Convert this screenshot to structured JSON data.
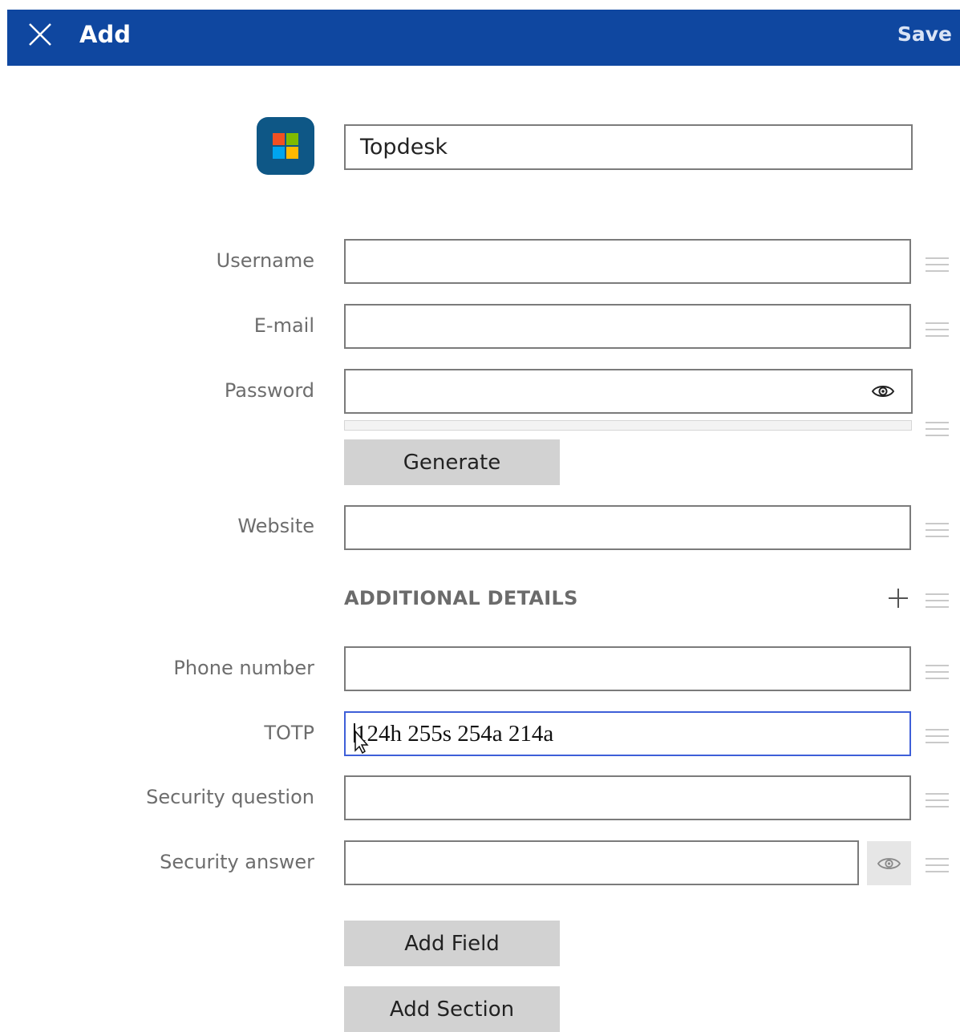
{
  "header": {
    "title": "Add",
    "save_label": "Save",
    "background_color": "#0f47a0"
  },
  "entry": {
    "title_value": "Topdesk",
    "icon": "windows-logo-icon"
  },
  "fields": {
    "username": {
      "label": "Username",
      "value": ""
    },
    "email": {
      "label": "E-mail",
      "value": ""
    },
    "password": {
      "label": "Password",
      "value": "",
      "strength_percent": 0
    },
    "website": {
      "label": "Website",
      "value": ""
    }
  },
  "generate_label": "Generate",
  "additional_details": {
    "title": "ADDITIONAL DETAILS",
    "phone_number": {
      "label": "Phone number",
      "value": ""
    },
    "totp": {
      "label": "TOTP",
      "value": "124h 255s 254a 214a"
    },
    "security_question": {
      "label": "Security question",
      "value": ""
    },
    "security_answer": {
      "label": "Security answer",
      "value": ""
    }
  },
  "add_field_label": "Add Field",
  "add_section_label": "Add Section",
  "colors": {
    "focus_border": "#3e5fd8",
    "button_gray": "#d2d2d2",
    "icon_tile": "#0e5786"
  }
}
